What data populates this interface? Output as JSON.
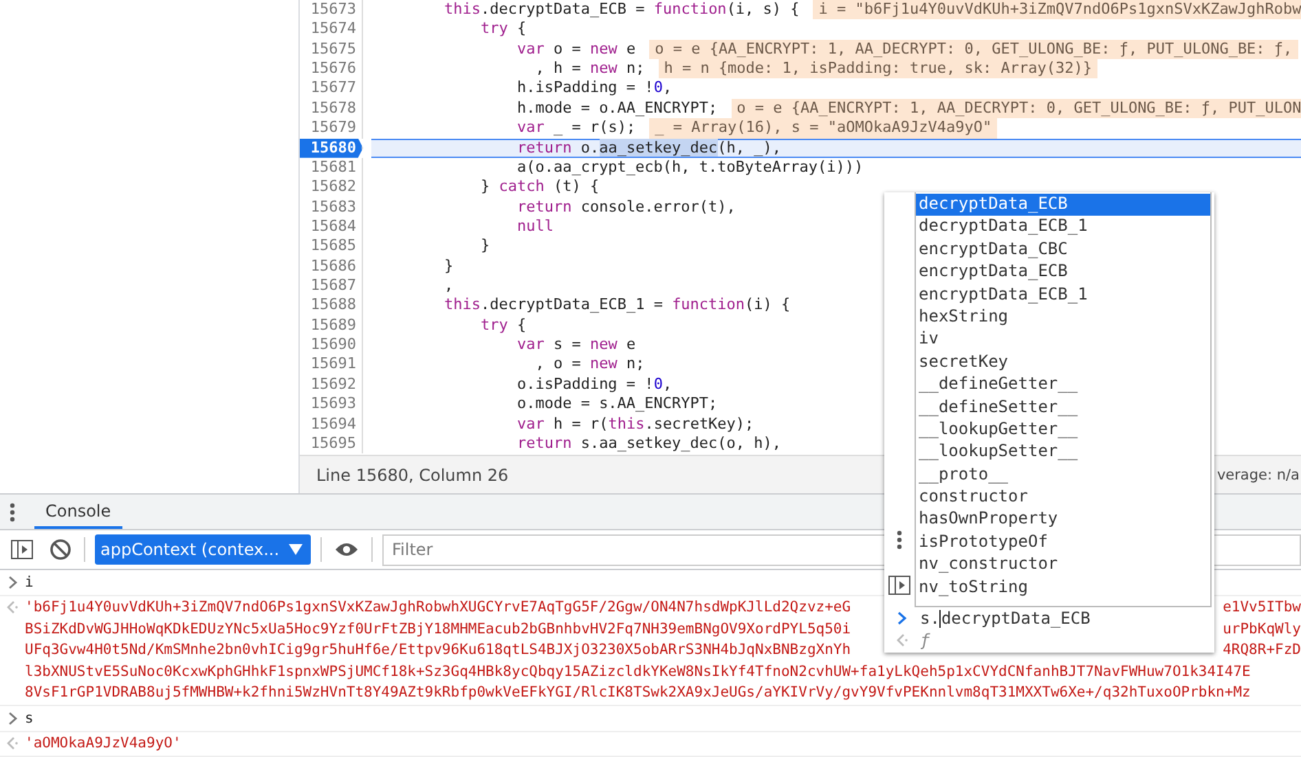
{
  "editor": {
    "lines": [
      {
        "number": "15673",
        "selected": false,
        "tokens": [
          {
            "kind": "kw",
            "t": "        this"
          },
          {
            "kind": "plain",
            "t": ".decryptData_ECB = "
          },
          {
            "kind": "kw",
            "t": "function"
          },
          {
            "kind": "plain",
            "t": "(i, s) {"
          }
        ],
        "annotation": "i = \"b6Fj1u4Y0uvVdKUh+3iZmQV7ndO6Ps1gxnSVxKZawJghRobw"
      },
      {
        "number": "15674",
        "selected": false,
        "tokens": [
          {
            "kind": "kw",
            "t": "            try"
          },
          {
            "kind": "plain",
            "t": " {"
          }
        ]
      },
      {
        "number": "15675",
        "selected": false,
        "tokens": [
          {
            "kind": "kw",
            "t": "                var"
          },
          {
            "kind": "plain",
            "t": " o = "
          },
          {
            "kind": "kw",
            "t": "new"
          },
          {
            "kind": "plain",
            "t": " e"
          }
        ],
        "annotation": "o = e {AA_ENCRYPT: 1, AA_DECRYPT: 0, GET_ULONG_BE: ƒ, PUT_ULONG_BE: ƒ,"
      },
      {
        "number": "15676",
        "selected": false,
        "tokens": [
          {
            "kind": "plain",
            "t": "                  , h = "
          },
          {
            "kind": "kw",
            "t": "new"
          },
          {
            "kind": "plain",
            "t": " n;"
          }
        ],
        "annotation": "h = n {mode: 1, isPadding: true, sk: Array(32)}"
      },
      {
        "number": "15677",
        "selected": false,
        "tokens": [
          {
            "kind": "plain",
            "t": "                h.isPadding = !"
          },
          {
            "kind": "num",
            "t": "0"
          },
          {
            "kind": "plain",
            "t": ","
          }
        ]
      },
      {
        "number": "15678",
        "selected": false,
        "tokens": [
          {
            "kind": "plain",
            "t": "                h.mode = o.AA_ENCRYPT;"
          }
        ],
        "annotation": "o = e {AA_ENCRYPT: 1, AA_DECRYPT: 0, GET_ULONG_BE: ƒ, PUT_ULON"
      },
      {
        "number": "15679",
        "selected": false,
        "tokens": [
          {
            "kind": "kw",
            "t": "                var"
          },
          {
            "kind": "plain",
            "t": " _ = r(s);"
          }
        ],
        "annotation": "_ = Array(16), s = \"aOMOkaA9JzV4a9yO\""
      },
      {
        "number": "15680",
        "selected": true,
        "tokens": [
          {
            "kind": "kw",
            "t": "                return"
          },
          {
            "kind": "plain",
            "t": " o."
          },
          {
            "kind": "sel",
            "t": "aa_setkey_dec"
          },
          {
            "kind": "plain",
            "t": "(h, _),"
          }
        ]
      },
      {
        "number": "15681",
        "selected": false,
        "tokens": [
          {
            "kind": "plain",
            "t": "                a(o.aa_crypt_ecb(h, t.toByteArray(i)))"
          }
        ]
      },
      {
        "number": "15682",
        "selected": false,
        "tokens": [
          {
            "kind": "plain",
            "t": "            } "
          },
          {
            "kind": "kw",
            "t": "catch"
          },
          {
            "kind": "plain",
            "t": " (t) {"
          }
        ]
      },
      {
        "number": "15683",
        "selected": false,
        "tokens": [
          {
            "kind": "kw",
            "t": "                return"
          },
          {
            "kind": "plain",
            "t": " console.error(t),"
          }
        ]
      },
      {
        "number": "15684",
        "selected": false,
        "tokens": [
          {
            "kind": "kw",
            "t": "                null"
          }
        ]
      },
      {
        "number": "15685",
        "selected": false,
        "tokens": [
          {
            "kind": "plain",
            "t": "            }"
          }
        ]
      },
      {
        "number": "15686",
        "selected": false,
        "tokens": [
          {
            "kind": "plain",
            "t": "        }"
          }
        ]
      },
      {
        "number": "15687",
        "selected": false,
        "tokens": [
          {
            "kind": "plain",
            "t": "        ,"
          }
        ]
      },
      {
        "number": "15688",
        "selected": false,
        "tokens": [
          {
            "kind": "kw",
            "t": "        this"
          },
          {
            "kind": "plain",
            "t": ".decryptData_ECB_1 = "
          },
          {
            "kind": "kw",
            "t": "function"
          },
          {
            "kind": "plain",
            "t": "(i) {"
          }
        ]
      },
      {
        "number": "15689",
        "selected": false,
        "tokens": [
          {
            "kind": "kw",
            "t": "            try"
          },
          {
            "kind": "plain",
            "t": " {"
          }
        ]
      },
      {
        "number": "15690",
        "selected": false,
        "tokens": [
          {
            "kind": "kw",
            "t": "                var"
          },
          {
            "kind": "plain",
            "t": " s = "
          },
          {
            "kind": "kw",
            "t": "new"
          },
          {
            "kind": "plain",
            "t": " e"
          }
        ]
      },
      {
        "number": "15691",
        "selected": false,
        "tokens": [
          {
            "kind": "plain",
            "t": "                  , o = "
          },
          {
            "kind": "kw",
            "t": "new"
          },
          {
            "kind": "plain",
            "t": " n;"
          }
        ]
      },
      {
        "number": "15692",
        "selected": false,
        "tokens": [
          {
            "kind": "plain",
            "t": "                o.isPadding = !"
          },
          {
            "kind": "num",
            "t": "0"
          },
          {
            "kind": "plain",
            "t": ","
          }
        ]
      },
      {
        "number": "15693",
        "selected": false,
        "tokens": [
          {
            "kind": "plain",
            "t": "                o.mode = s.AA_ENCRYPT;"
          }
        ]
      },
      {
        "number": "15694",
        "selected": false,
        "tokens": [
          {
            "kind": "kw",
            "t": "                var"
          },
          {
            "kind": "plain",
            "t": " h = r("
          },
          {
            "kind": "kw",
            "t": "this"
          },
          {
            "kind": "plain",
            "t": ".secretKey);"
          }
        ]
      },
      {
        "number": "15695",
        "selected": false,
        "tokens": [
          {
            "kind": "kw",
            "t": "                return"
          },
          {
            "kind": "plain",
            "t": " s.aa_setkey_dec(o, h),"
          }
        ]
      }
    ],
    "status": {
      "position": "Line 15680, Column 26",
      "coverage": "verage: n/a"
    }
  },
  "console": {
    "tabs": [
      {
        "label": "Console",
        "selected": true
      }
    ],
    "context": "appContext (contex...",
    "filter": {
      "placeholder": "Filter"
    },
    "entries": [
      {
        "kind": "input",
        "text": "i"
      },
      {
        "kind": "output",
        "lines": [
          {
            "left": "'b6Fj1u4Y0uvVdKUh+3iZmQV7ndO6Ps1gxnSVxKZawJghRobwhXUGCYrvE7AqTgG5F/2Ggw/ON4N7hsdWpKJlLd2Qzvz+eG",
            "right": "e1Vv5ITbw"
          },
          {
            "left": "BSiZKdDvWGJHHoWqKDkEDUzYNc5xUa5Hoc9Yzf0UrFtZBjY18MHMEacub2bGBnhbvHV2Fq7NH39emBNgOV9XordPYL5q50i",
            "right": "urPbKqWly"
          },
          {
            "left": "UFq3Gvw4H0t5Nd/KmSMnhe2bn0vhICig9gr5huHf6e/Ettpv96Ku618qtLS4BJXjO3230X5obARrS3NH4bJqNxBNBzgXnYh",
            "right": "4RQ8R+FzD"
          },
          {
            "left": "l3bXNUStvE5SuNoc0KcxwKphGHhkF1spnxWPSjUMCf18k+Sz3Gq4HBk8ycQbqy15AZizcldkYKeW8NsIkYf4TfnoN2cvhUW+fa1yLkQeh5p1xCVYdCNfanhBJT7NavFWHuw7O1k34I47E"
          },
          {
            "left": "8VsF1rGP1VDRAB8uj5fMWHBW+k2fhni5WzHVnTt8Y49AZt9kRbfp0wkVeEFkYGI/RlcIK8TSwk2XA9xJeUGs/aYKIVrVy/gvY9VfvPEKnnlvm8qT31MXXTw6Xe+/q32hTuxoOPrbkn+Mz"
          }
        ]
      },
      {
        "kind": "input",
        "text": "s"
      },
      {
        "kind": "output",
        "lines": [
          {
            "left": "'aOMOkaA9JzV4a9yO'"
          }
        ]
      }
    ]
  },
  "autocomplete": {
    "items": [
      {
        "label": "decryptData_ECB",
        "selected": true
      },
      {
        "label": "decryptData_ECB_1",
        "selected": false
      },
      {
        "label": "encryptData_CBC",
        "selected": false
      },
      {
        "label": "encryptData_ECB",
        "selected": false
      },
      {
        "label": "encryptData_ECB_1",
        "selected": false
      },
      {
        "label": "hexString",
        "selected": false
      },
      {
        "label": "iv",
        "selected": false
      },
      {
        "label": "secretKey",
        "selected": false
      },
      {
        "label": "__defineGetter__",
        "selected": false
      },
      {
        "label": "__defineSetter__",
        "selected": false
      },
      {
        "label": "__lookupGetter__",
        "selected": false
      },
      {
        "label": "__lookupSetter__",
        "selected": false
      },
      {
        "label": "__proto__",
        "selected": false
      },
      {
        "label": "constructor",
        "selected": false
      },
      {
        "label": "hasOwnProperty",
        "selected": false
      },
      {
        "label": "isPrototypeOf",
        "selected": false
      },
      {
        "label": "nv_constructor",
        "selected": false
      },
      {
        "label": "nv_toString",
        "selected": false
      }
    ],
    "typed": "s.",
    "completion": "decryptData_ECB",
    "preview": "ƒ"
  }
}
